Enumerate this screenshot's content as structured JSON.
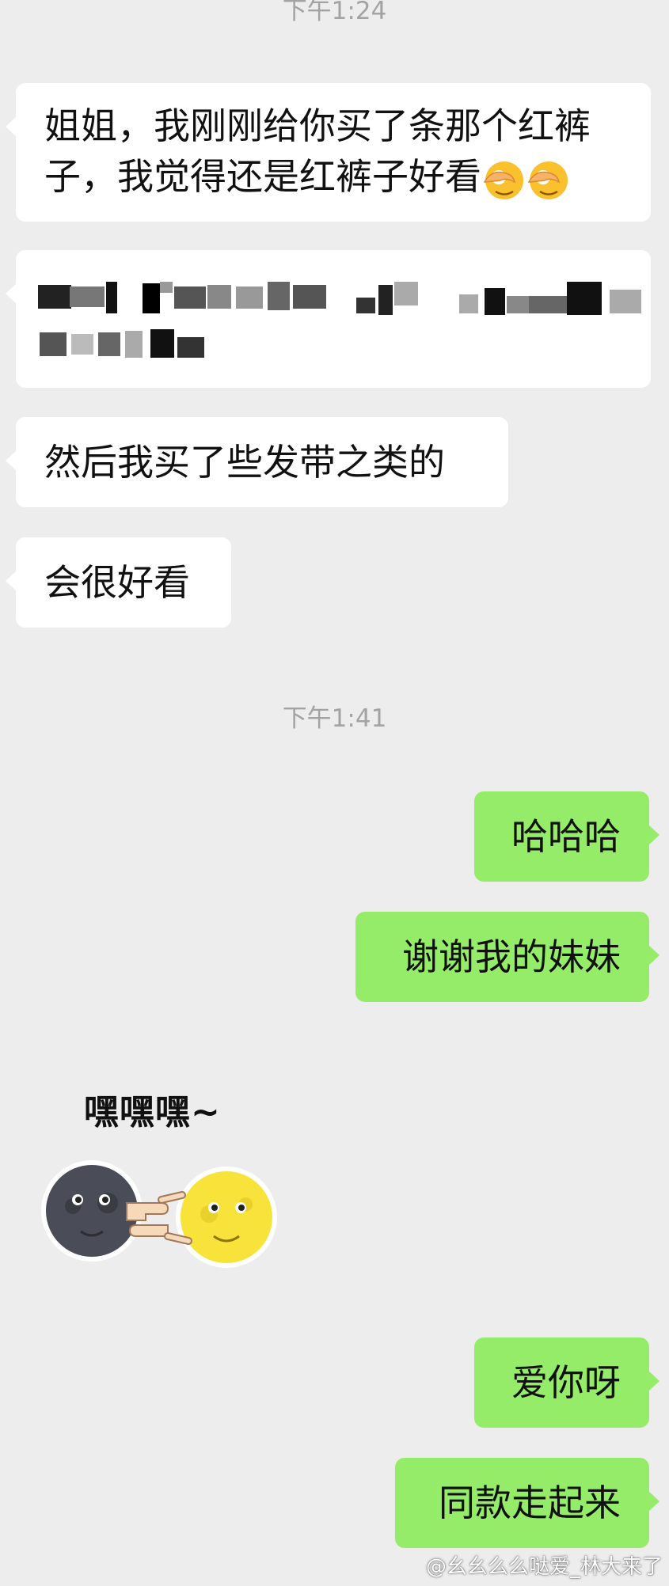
{
  "timestamps": [
    "下午1:24",
    "下午1:41"
  ],
  "messages": {
    "m1_line1": "姐姐，我刚刚给你买了条那个红裤",
    "m1_line2": "子，我觉得还是红裤子好看",
    "m3": "然后我买了些发带之类的",
    "m4": "会很好看",
    "m5": "哈哈哈",
    "m6": "谢谢我的妹妹",
    "m8": "爱你呀",
    "m9": "同款走起来"
  },
  "sticker": {
    "caption": "嘿嘿嘿~"
  },
  "icons": {
    "m1_emoji": "peeking-eye-face-icon",
    "sticker_art": "new-moon-and-full-moon-face-pointing-icon"
  },
  "colors": {
    "background": "#ededed",
    "incoming": "#ffffff",
    "outgoing": "#95ec69",
    "timestamp": "#a3a3a3"
  },
  "watermark": "@幺幺么么哒爱_林大来了"
}
